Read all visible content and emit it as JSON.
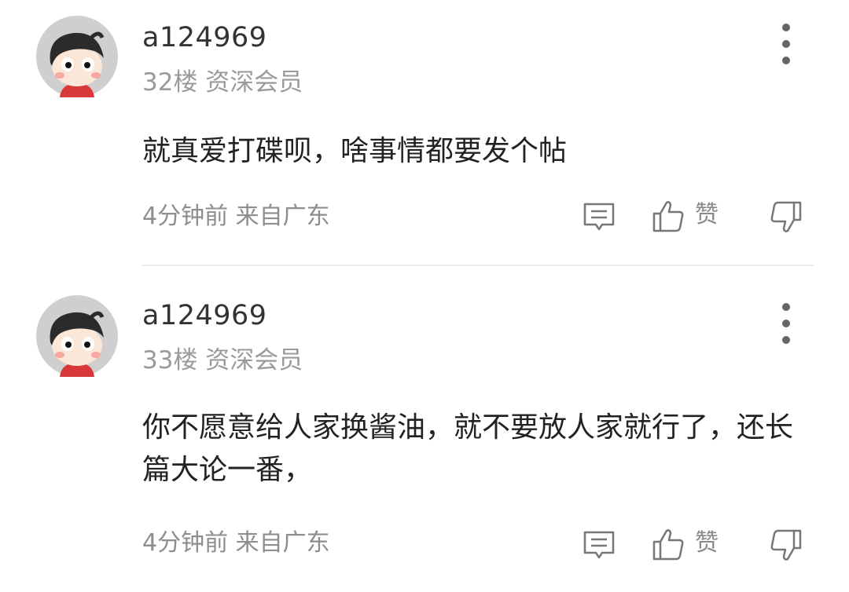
{
  "comments": [
    {
      "username": "a124969",
      "floor_meta": "32楼 资深会员",
      "content": "就真爱打碟呗，啥事情都要发个帖",
      "time_location": "4分钟前 来自广东",
      "like_label": "赞"
    },
    {
      "username": "a124969",
      "floor_meta": "33楼 资深会员",
      "content": "你不愿意给人家换酱油，就不要放人家就行了，还长篇大论一番，",
      "time_location": "4分钟前 来自广东",
      "like_label": "赞"
    }
  ],
  "colors": {
    "avatar_bg": "#cfcfcf",
    "text_primary": "#222222",
    "text_secondary": "#9a9a9a",
    "divider": "#ececec"
  },
  "icons": [
    "more-icon",
    "reply-icon",
    "thumb-up-icon",
    "thumb-down-icon"
  ]
}
